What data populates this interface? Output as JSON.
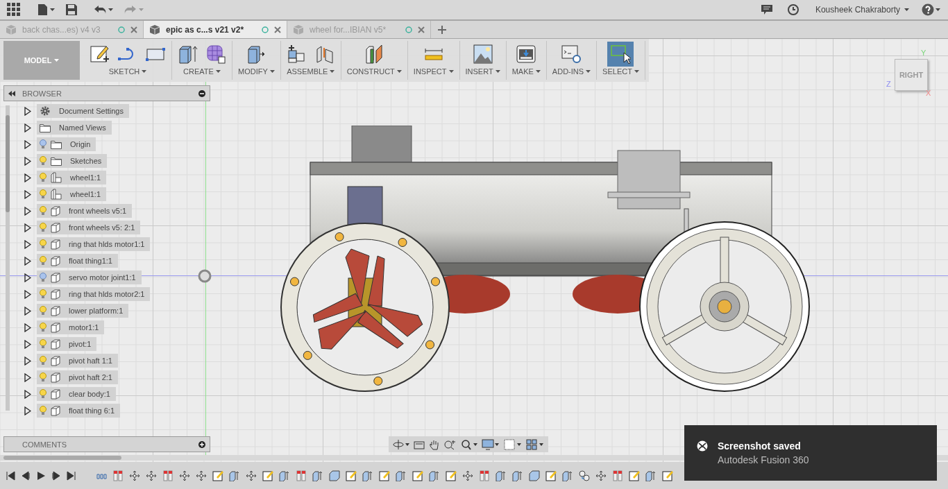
{
  "top_bar": {
    "user": "Kousheek Chakraborty"
  },
  "tabs": [
    {
      "label": "back chas...es) v4 v3",
      "selected": false
    },
    {
      "label": "epic as c...s v21 v2*",
      "selected": true
    },
    {
      "label": "wheel for...IBIAN v5*",
      "selected": false
    }
  ],
  "toolbar": {
    "workspace": "MODEL",
    "groups": [
      {
        "label": "SKETCH",
        "kind": "sketch"
      },
      {
        "label": "CREATE",
        "kind": "create"
      },
      {
        "label": "MODIFY",
        "kind": "modify"
      },
      {
        "label": "ASSEMBLE",
        "kind": "assemble"
      },
      {
        "label": "CONSTRUCT",
        "kind": "construct"
      },
      {
        "label": "INSPECT",
        "kind": "inspect"
      },
      {
        "label": "INSERT",
        "kind": "insert"
      },
      {
        "label": "MAKE",
        "kind": "make"
      },
      {
        "label": "ADD-INS",
        "kind": "addins"
      },
      {
        "label": "SELECT",
        "kind": "select",
        "selected": true
      }
    ]
  },
  "browser": {
    "title": "BROWSER",
    "items": [
      {
        "label": "Document Settings",
        "kind": "settings"
      },
      {
        "label": "Named Views",
        "kind": "folder"
      },
      {
        "label": "Origin",
        "kind": "folder",
        "visible": false
      },
      {
        "label": "Sketches",
        "kind": "folder",
        "visible": true
      },
      {
        "label": "wheel1:1",
        "kind": "component",
        "visible": true
      },
      {
        "label": "wheel1:1",
        "kind": "component",
        "visible": true
      },
      {
        "label": "front wheels v5:1",
        "kind": "body",
        "visible": true
      },
      {
        "label": "front wheels v5: 2:1",
        "kind": "body",
        "visible": true
      },
      {
        "label": "ring that hlds motor1:1",
        "kind": "body",
        "visible": true
      },
      {
        "label": "float thing1:1",
        "kind": "body",
        "visible": true
      },
      {
        "label": "servo motor joint1:1",
        "kind": "body",
        "visible": false
      },
      {
        "label": "ring that hlds motor2:1",
        "kind": "body",
        "visible": true
      },
      {
        "label": "lower platform:1",
        "kind": "body",
        "visible": true
      },
      {
        "label": "motor1:1",
        "kind": "body",
        "visible": true
      },
      {
        "label": "pivot:1",
        "kind": "body",
        "visible": true
      },
      {
        "label": "pivot haft 1:1",
        "kind": "body",
        "visible": true
      },
      {
        "label": "pivot haft 2:1",
        "kind": "body",
        "visible": true
      },
      {
        "label": "clear body:1",
        "kind": "body",
        "visible": true
      },
      {
        "label": "float thing 6:1",
        "kind": "body",
        "visible": true
      }
    ]
  },
  "comments": {
    "title": "COMMENTS"
  },
  "view_cube": {
    "face": "RIGHT",
    "axis_y": "Y",
    "axis_z": "Z",
    "axis_x": "X"
  },
  "toast": {
    "title": "Screenshot saved",
    "subtitle": "Autodesk Fusion 360"
  }
}
